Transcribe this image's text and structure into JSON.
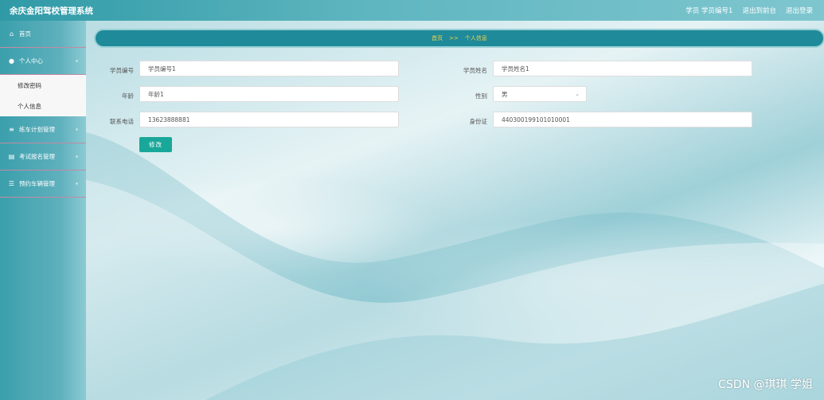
{
  "app": {
    "title": "余庆金阳驾校管理系统"
  },
  "topbar": {
    "user": "学员 学员编号1",
    "front": "退出到前台",
    "logout": "退出登录"
  },
  "sidebar": {
    "items": [
      {
        "label": "首页",
        "icon": "home-icon"
      },
      {
        "label": "个人中心",
        "icon": "user-icon"
      },
      {
        "label": "练车计划管理",
        "icon": "sliders-icon"
      },
      {
        "label": "考试报名管理",
        "icon": "printer-icon"
      },
      {
        "label": "预约车辆管理",
        "icon": "list-icon"
      }
    ],
    "submenu": [
      {
        "label": "修改密码"
      },
      {
        "label": "个人信息"
      }
    ]
  },
  "breadcrumb": {
    "home": "首页",
    "sep": ">>",
    "current": "个人信息"
  },
  "form": {
    "student_no_label": "学员编号",
    "student_no_value": "学员编号1",
    "student_name_label": "学员姓名",
    "student_name_value": "学员姓名1",
    "age_label": "年龄",
    "age_value": "年龄1",
    "gender_label": "性别",
    "gender_value": "男",
    "phone_label": "联系电话",
    "phone_value": "13623888881",
    "id_label": "身份证",
    "id_value": "440300199101010001",
    "submit_label": "修改"
  },
  "watermark": "CSDN @琪琪 学姐",
  "colors": {
    "accent": "#1f8a99",
    "button": "#19a79a",
    "crumb_text": "#f2d34a"
  }
}
